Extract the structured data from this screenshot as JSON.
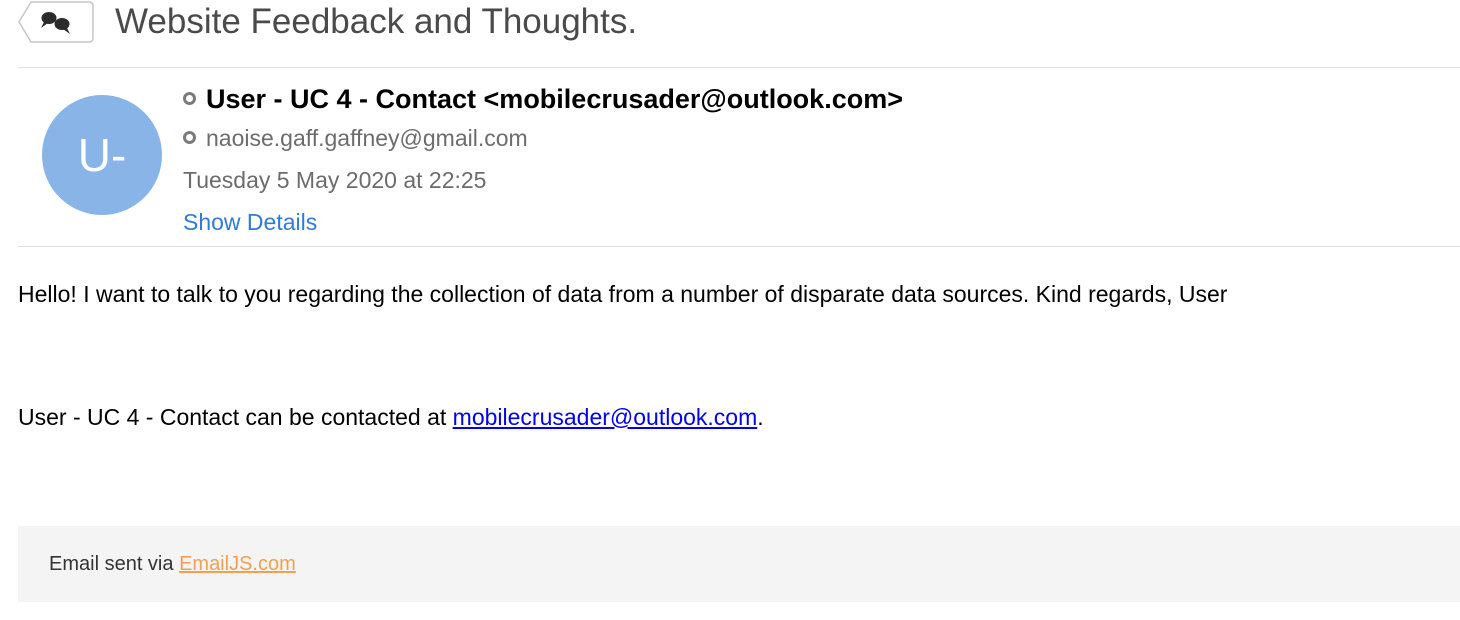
{
  "subject": {
    "title": "Website Feedback and Thoughts.",
    "thread_icon": "speech-bubbles-icon"
  },
  "header": {
    "avatar_initials": "U-",
    "avatar_color": "#88b4e8",
    "from": "User - UC 4 - Contact <mobilecrusader@outlook.com>",
    "to": "naoise.gaff.gaffney@gmail.com",
    "date": "Tuesday 5 May 2020 at 22:25",
    "show_details_label": "Show Details"
  },
  "body": {
    "paragraph": "Hello! I want to talk to you regarding the collection of data from a number of disparate data sources. Kind regards, User",
    "contact_prefix": "User - UC 4 - Contact can be contacted at ",
    "contact_email": "mobilecrusader@outlook.com",
    "contact_suffix": "."
  },
  "footer": {
    "prefix": "Email sent via ",
    "link_label": "EmailJS.com",
    "link_color": "#f0a050"
  },
  "colors": {
    "link_blue": "#2f7bd7",
    "hyperlink": "#0000ee"
  }
}
